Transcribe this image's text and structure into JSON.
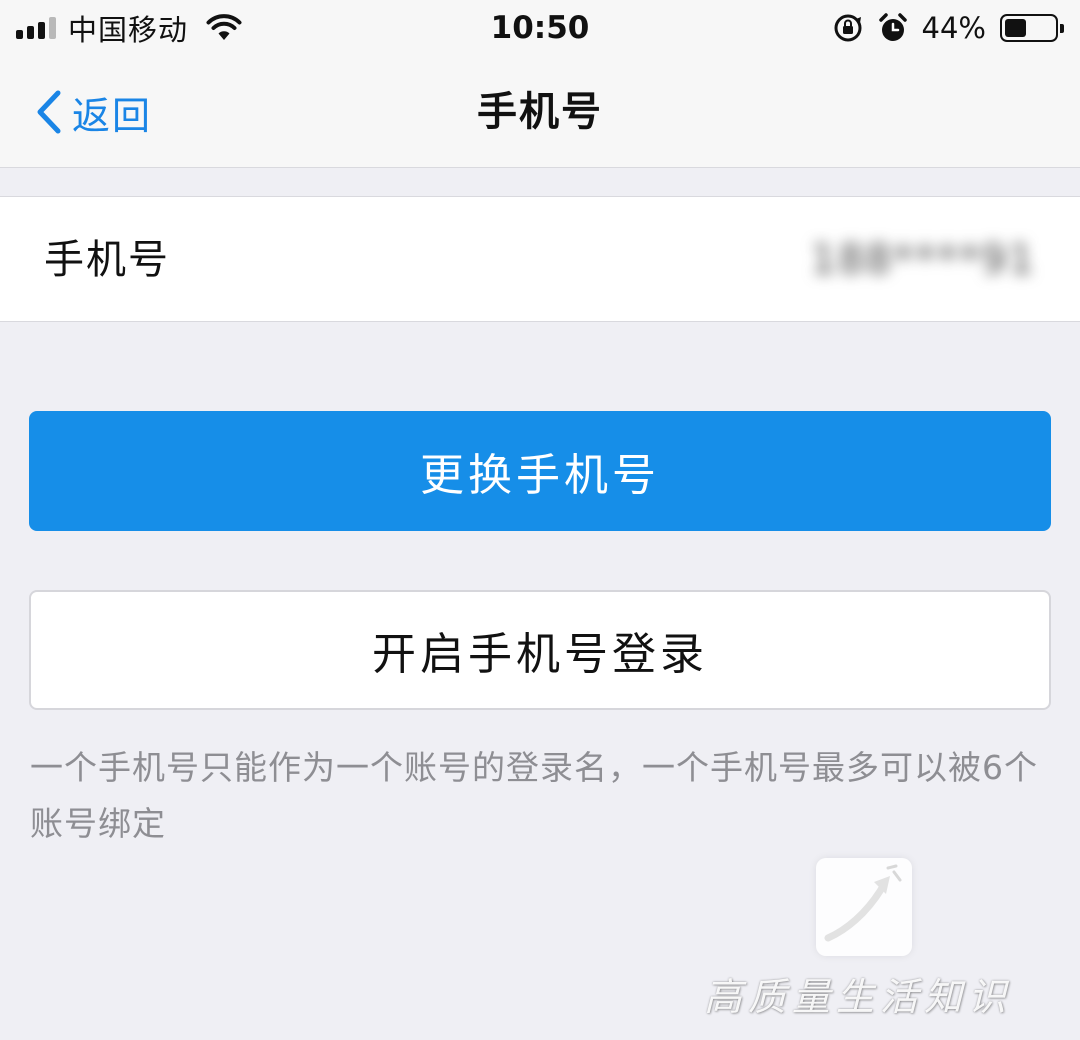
{
  "status_bar": {
    "carrier": "中国移动",
    "time": "10:50",
    "battery_percent": "44%",
    "battery_level": 0.44
  },
  "nav": {
    "back_label": "返回",
    "title": "手机号"
  },
  "phone_row": {
    "label": "手机号",
    "value": "188****91"
  },
  "buttons": {
    "change_phone": "更换手机号",
    "enable_phone_login": "开启手机号登录"
  },
  "hint": "一个手机号只能作为一个账号的登录名，一个手机号最多可以被6个账号绑定",
  "watermark": {
    "text": "高质量生活知识"
  },
  "colors": {
    "accent": "#168ee8",
    "back_link": "#1a85e6",
    "background": "#efeff4"
  }
}
